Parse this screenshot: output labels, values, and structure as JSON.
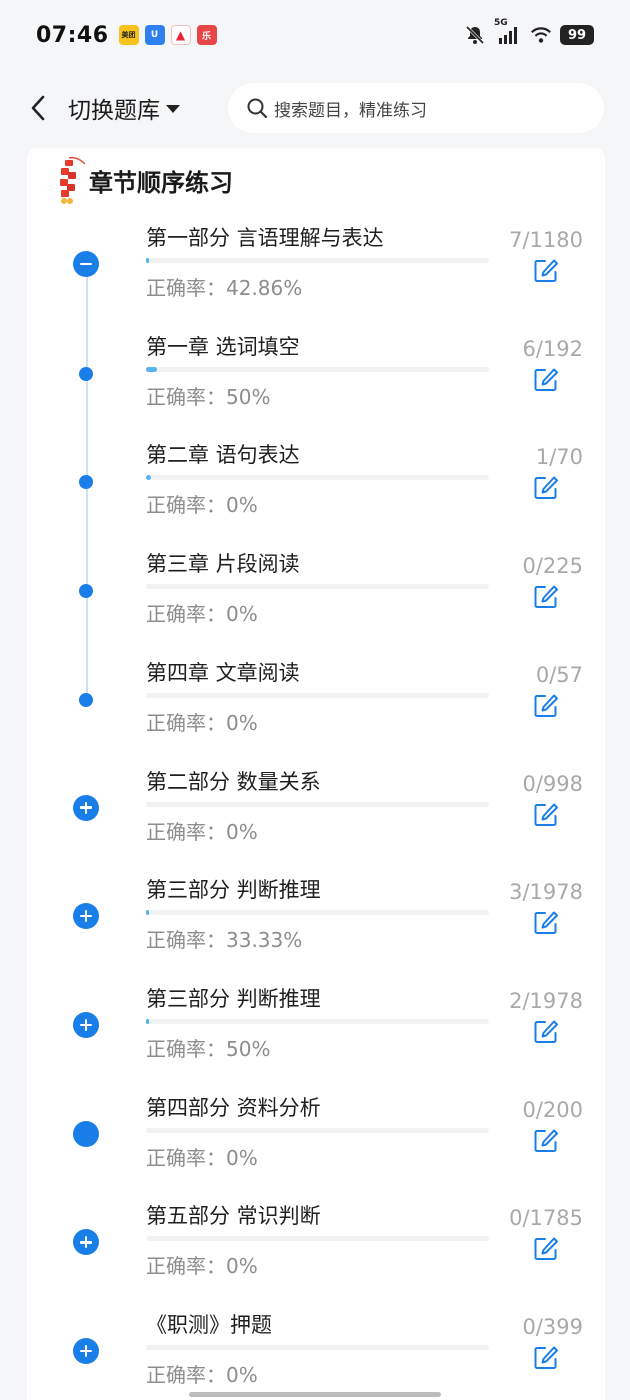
{
  "status_bar": {
    "time": "07:46",
    "apps": [
      "美团",
      "U",
      "▲",
      "乐"
    ],
    "network": "5G",
    "battery": "99"
  },
  "header": {
    "title": "切换题库",
    "search_placeholder": "搜索题目，精准练习"
  },
  "section": {
    "title": "章节顺序练习"
  },
  "accuracy_prefix": "正确率：",
  "rows": [
    {
      "title": "第一部分 言语理解与表达",
      "accuracy": "正确率：42.86%",
      "count": "7/1180",
      "node": "minus",
      "progress": 0.006
    },
    {
      "title": "第一章 选词填空",
      "accuracy": "正确率：50%",
      "count": "6/192",
      "node": "dot",
      "progress": 0.031
    },
    {
      "title": "第二章 语句表达",
      "accuracy": "正确率：0%",
      "count": "1/70",
      "node": "dot",
      "progress": 0.014
    },
    {
      "title": "第三章 片段阅读",
      "accuracy": "正确率：0%",
      "count": "0/225",
      "node": "dot",
      "progress": 0
    },
    {
      "title": "第四章 文章阅读",
      "accuracy": "正确率：0%",
      "count": "0/57",
      "node": "dot",
      "progress": 0
    },
    {
      "title": "第二部分 数量关系",
      "accuracy": "正确率：0%",
      "count": "0/998",
      "node": "plus",
      "progress": 0
    },
    {
      "title": "第三部分 判断推理",
      "accuracy": "正确率：33.33%",
      "count": "3/1978",
      "node": "plus",
      "progress": 0.0015
    },
    {
      "title": "第三部分 判断推理",
      "accuracy": "正确率：50%",
      "count": "2/1978",
      "node": "plus",
      "progress": 0.001
    },
    {
      "title": "第四部分 资料分析",
      "accuracy": "正确率：0%",
      "count": "0/200",
      "node": "solid",
      "progress": 0
    },
    {
      "title": "第五部分 常识判断",
      "accuracy": "正确率：0%",
      "count": "0/1785",
      "node": "plus",
      "progress": 0
    },
    {
      "title": "《职测》押题",
      "accuracy": "正确率：0%",
      "count": "0/399",
      "node": "plus",
      "progress": 0
    }
  ],
  "colors": {
    "accent": "#1a7ee8",
    "progress": "#55b4f0"
  }
}
